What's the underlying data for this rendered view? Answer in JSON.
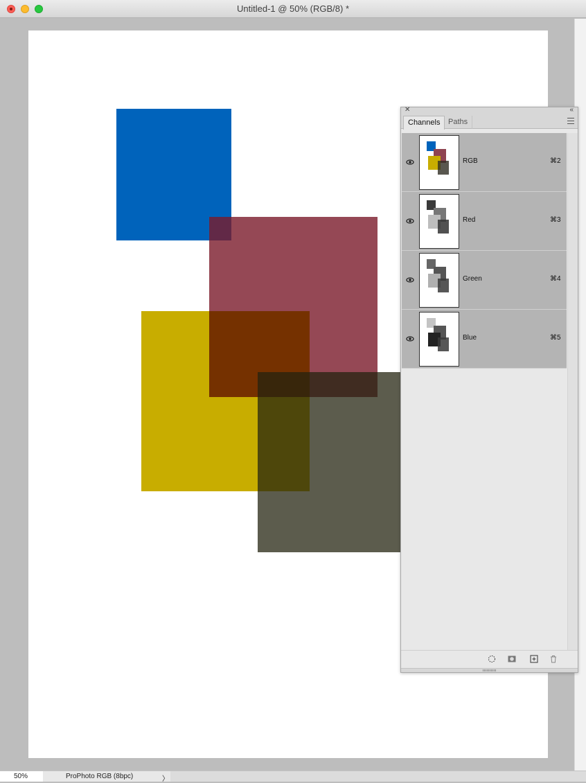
{
  "window": {
    "title": "Untitled-1 @ 50% (RGB/8) *"
  },
  "canvas": {
    "colors": {
      "background": "#bdbdbd",
      "document": "#ffffff",
      "blue_square": "#0063bb",
      "red_square": "#8f4451",
      "yellow_square": "#c8ad00",
      "gray_square": "#5a584c"
    }
  },
  "statusbar": {
    "zoom": "50%",
    "doc_info": "ProPhoto RGB (8bpc)",
    "arrow": "〉"
  },
  "panel": {
    "tabs": [
      {
        "label": "Channels",
        "active": true
      },
      {
        "label": "Paths",
        "active": false
      }
    ],
    "channels": [
      {
        "name": "RGB",
        "shortcut": "⌘2",
        "visible": true,
        "icon": "eye-icon"
      },
      {
        "name": "Red",
        "shortcut": "⌘3",
        "visible": true,
        "icon": "eye-icon"
      },
      {
        "name": "Green",
        "shortcut": "⌘4",
        "visible": true,
        "icon": "eye-icon"
      },
      {
        "name": "Blue",
        "shortcut": "⌘5",
        "visible": true,
        "icon": "eye-icon"
      }
    ],
    "footer_icons": [
      "load-selection-icon",
      "save-selection-mask-icon",
      "new-channel-icon",
      "delete-channel-icon"
    ],
    "header_icons": [
      "close-icon",
      "collapse-icon",
      "panel-menu-icon"
    ]
  }
}
